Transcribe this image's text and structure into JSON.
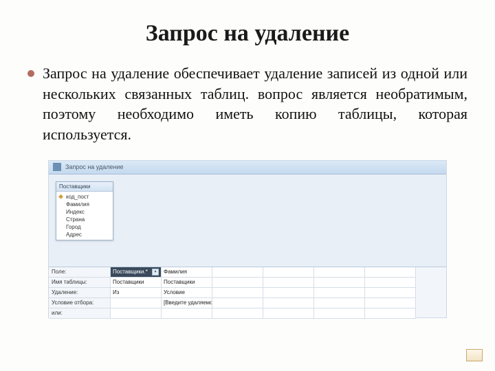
{
  "title": "Запрос на удаление",
  "body": "Запрос на удаление обеспечивает удаление записей из одной или нескольких связанных таблиц. вопрос является необратимым, поэтому необходимо иметь копию таблицы, которая используется.",
  "screenshot": {
    "window_title": "Запрос на удаление",
    "fieldlist": {
      "header": "Поставщики",
      "items": [
        "код_пост",
        "Фамилия",
        "Индекс",
        "Страна",
        "Город",
        "Адрес"
      ]
    },
    "grid": {
      "row_headers": [
        "Поле:",
        "Имя таблицы:",
        "Удаление:",
        "Условие отбора:",
        "или:"
      ],
      "col1": {
        "field": "Поставщики.*",
        "table": "Поставщики",
        "delete": "Из",
        "crit": "",
        "or": ""
      },
      "col2": {
        "field": "Фамилия",
        "table": "Поставщики",
        "delete": "Условие",
        "crit": "[Введите удаляемого]",
        "or": ""
      }
    }
  }
}
